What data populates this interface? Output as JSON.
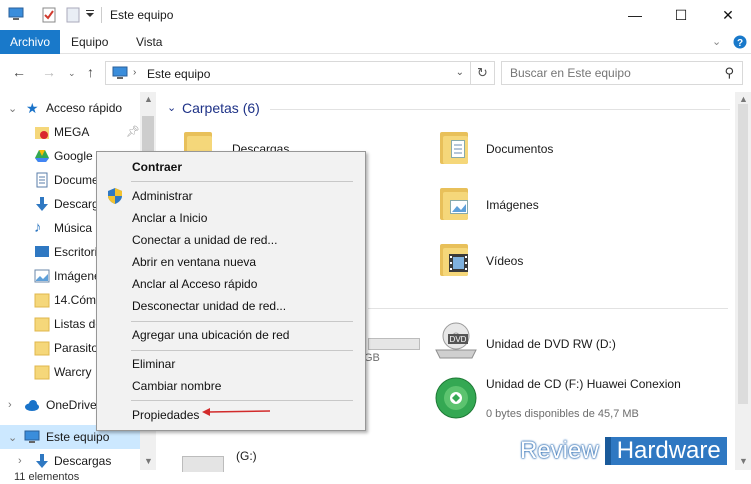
{
  "window": {
    "title": "Este equipo",
    "minimize": "—",
    "maximize": "☐",
    "close": "✕"
  },
  "ribbon": {
    "tabs": [
      "Archivo",
      "Equipo",
      "Vista"
    ]
  },
  "address_bar": {
    "path": "Este equipo",
    "search_placeholder": "Buscar en Este equipo"
  },
  "sidebar": {
    "quick_access": "Acceso rápido",
    "items": [
      "MEGA",
      "Google D",
      "Docume",
      "Descarg",
      "Música",
      "Escritori",
      "Imágene",
      "14.Cómo",
      "Listas de",
      "Parasito",
      "Warcry"
    ],
    "onedrive": "OneDrive",
    "this_pc": "Este equipo",
    "downloads": "Descargas"
  },
  "main": {
    "folders_header": "Carpetas (6)",
    "folders": [
      "Descargas",
      "Documentos",
      "Imágenes",
      "Vídeos"
    ],
    "devices": {
      "partial_size_text": "GB",
      "dvd_label": "Unidad de DVD RW (D:)",
      "cd_label": "Unidad de CD (F:) Huawei Conexion",
      "cd_free": "0 bytes disponibles de 45,7 MB",
      "g_label": "(G:)"
    }
  },
  "context_menu": {
    "items": [
      {
        "label": "Contraer",
        "bold": true
      },
      {
        "label": "Administrar"
      },
      {
        "label": "Anclar a Inicio"
      },
      {
        "label": "Conectar a unidad de red..."
      },
      {
        "label": "Abrir en ventana nueva"
      },
      {
        "label": "Anclar al Acceso rápido"
      },
      {
        "label": "Desconectar unidad de red..."
      },
      {
        "label": "Agregar una ubicación de red"
      },
      {
        "label": "Eliminar"
      },
      {
        "label": "Cambiar nombre"
      },
      {
        "label": "Propiedades"
      }
    ],
    "arrow_color": "#d22b2b"
  },
  "status_bar": {
    "text": "11 elementos"
  },
  "watermark": {
    "left": "Review",
    "right": "Hardware"
  },
  "colors": {
    "accent": "#1979ca",
    "selection": "#cce8ff",
    "header_text": "#1e3287"
  }
}
